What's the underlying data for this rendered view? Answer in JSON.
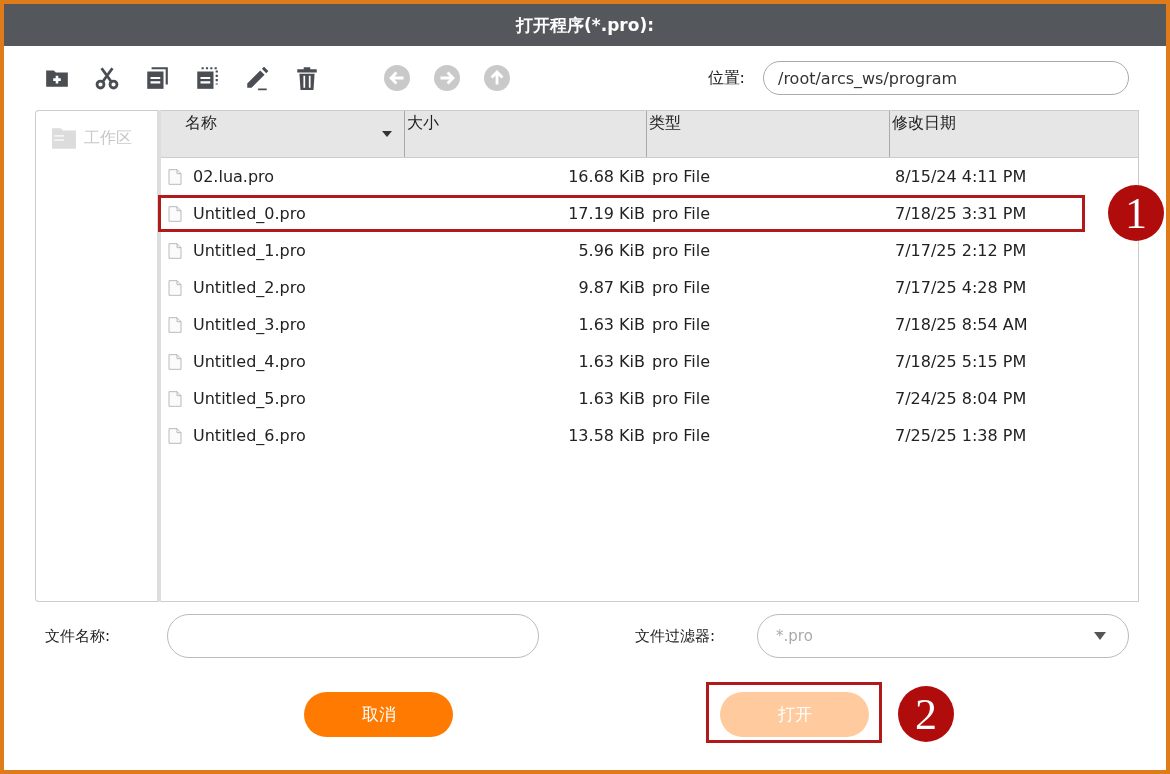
{
  "window": {
    "title": "打开程序(*.pro):"
  },
  "toolbar": {
    "location_label": "位置:",
    "location": "/root/arcs_ws/program"
  },
  "sidebar": {
    "items": [
      {
        "label": "工作区",
        "disabled": true
      }
    ]
  },
  "table": {
    "columns": [
      {
        "label": "名称",
        "sorted": true
      },
      {
        "label": "大小",
        "sorted": false
      },
      {
        "label": "类型",
        "sorted": false
      },
      {
        "label": "修改日期",
        "sorted": false
      }
    ],
    "rows": [
      {
        "name": "02.lua.pro",
        "size": "16.68 KiB",
        "type": "pro File",
        "modified": "8/15/24 4:11 PM"
      },
      {
        "name": "Untitled_0.pro",
        "size": "17.19 KiB",
        "type": "pro File",
        "modified": "7/18/25 3:31 PM",
        "callout": "1"
      },
      {
        "name": "Untitled_1.pro",
        "size": "5.96 KiB",
        "type": "pro File",
        "modified": "7/17/25 2:12 PM"
      },
      {
        "name": "Untitled_2.pro",
        "size": "9.87 KiB",
        "type": "pro File",
        "modified": "7/17/25 4:28 PM"
      },
      {
        "name": "Untitled_3.pro",
        "size": "1.63 KiB",
        "type": "pro File",
        "modified": "7/18/25 8:54 AM"
      },
      {
        "name": "Untitled_4.pro",
        "size": "1.63 KiB",
        "type": "pro File",
        "modified": "7/18/25 5:15 PM"
      },
      {
        "name": "Untitled_5.pro",
        "size": "1.63 KiB",
        "type": "pro File",
        "modified": "7/24/25 8:04 PM"
      },
      {
        "name": "Untitled_6.pro",
        "size": "13.58 KiB",
        "type": "pro File",
        "modified": "7/25/25 1:38 PM"
      }
    ]
  },
  "file_name": {
    "label": "文件名称:"
  },
  "filter": {
    "label": "文件过滤器:",
    "placeholder": "*.pro"
  },
  "buttons": [
    {
      "label": "取消",
      "disabled": false
    },
    {
      "label": "打开",
      "disabled": true,
      "callout": "2"
    }
  ]
}
